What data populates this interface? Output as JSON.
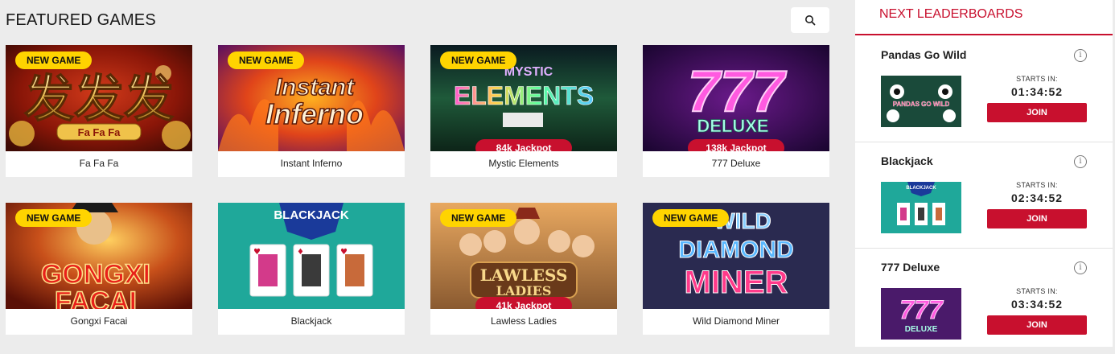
{
  "main": {
    "title": "FEATURED GAMES",
    "games": [
      {
        "name": "Fa Fa Fa",
        "new_badge": "NEW GAME",
        "jackpot": ""
      },
      {
        "name": "Instant Inferno",
        "new_badge": "NEW GAME",
        "jackpot": ""
      },
      {
        "name": "Mystic Elements",
        "new_badge": "NEW GAME",
        "jackpot": "84k Jackpot"
      },
      {
        "name": "777 Deluxe",
        "new_badge": "",
        "jackpot": "138k Jackpot"
      },
      {
        "name": "Gongxi Facai",
        "new_badge": "NEW GAME",
        "jackpot": ""
      },
      {
        "name": "Blackjack",
        "new_badge": "",
        "jackpot": ""
      },
      {
        "name": "Lawless Ladies",
        "new_badge": "NEW GAME",
        "jackpot": "41k Jackpot"
      },
      {
        "name": "Wild Diamond Miner",
        "new_badge": "NEW GAME",
        "jackpot": ""
      }
    ],
    "art": {
      "fafafa": "发发发",
      "fafafa_sub": "Fa Fa Fa",
      "inferno1": "Instant",
      "inferno2": "Inferno",
      "mystic1": "MYSTIC",
      "mystic2": "ELEMENTS",
      "deluxe_num": "777",
      "deluxe_word": "DELUXE",
      "gongxi1": "GONGXI",
      "gongxi2": "FACAI",
      "bj_title": "BLACKJACK",
      "lawless1": "LAWLESS",
      "lawless2": "LADIES",
      "wild1": "WILD",
      "wild2": "DIAMOND",
      "wild3": "MINER"
    }
  },
  "sidebar": {
    "title": "NEXT LEADERBOARDS",
    "starts_label": "STARTS IN:",
    "join_label": "JOIN",
    "info_glyph": "i",
    "items": [
      {
        "name": "Pandas Go Wild",
        "time": "01:34:52",
        "art": "PANDAS GO WILD"
      },
      {
        "name": "Blackjack",
        "time": "02:34:52",
        "art": "BLACKJACK"
      },
      {
        "name": "777 Deluxe",
        "time": "03:34:52",
        "art": "DELUXE"
      }
    ]
  },
  "colors": {
    "accent_red": "#c8102e",
    "badge_yellow": "#ffd400",
    "background": "#ececec"
  }
}
